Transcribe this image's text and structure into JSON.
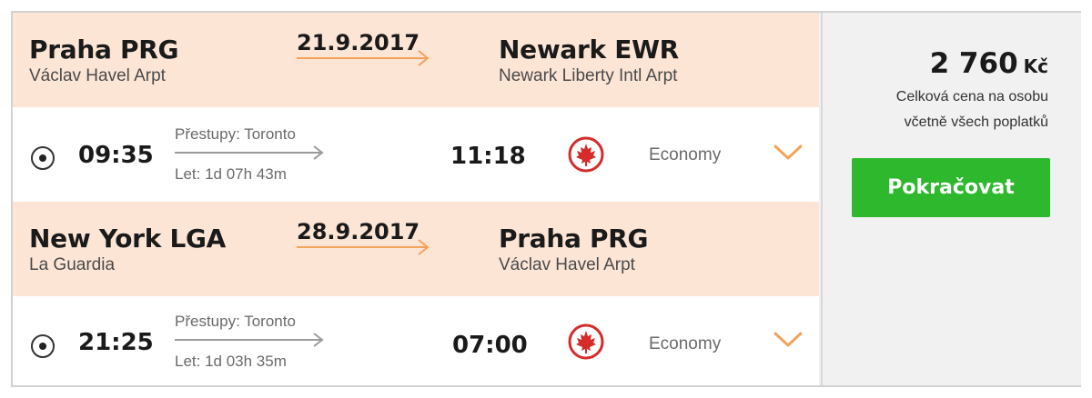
{
  "legs": [
    {
      "from_city": "Praha PRG",
      "from_airport": "Václav Havel Arpt",
      "date": "21.9.2017",
      "to_city": "Newark EWR",
      "to_airport": "Newark Liberty Intl Arpt",
      "depart": "09:35",
      "stops": "Přestupy: Toronto",
      "duration": "Let: 1d 07h 43m",
      "arrive": "11:18",
      "airline_icon": "maple-leaf-icon",
      "cabin": "Economy",
      "selected": true
    },
    {
      "from_city": "New York LGA",
      "from_airport": "La Guardia",
      "date": "28.9.2017",
      "to_city": "Praha PRG",
      "to_airport": "Václav Havel Arpt",
      "depart": "21:25",
      "stops": "Přestupy: Toronto",
      "duration": "Let: 1d 03h 35m",
      "arrive": "07:00",
      "airline_icon": "maple-leaf-icon",
      "cabin": "Economy",
      "selected": true
    }
  ],
  "price": {
    "amount": "2 760",
    "currency": "Kč",
    "note_line1": "Celková cena na osobu",
    "note_line2": "včetně všech poplatků"
  },
  "cta": {
    "label": "Pokračovat"
  },
  "colors": {
    "accent_orange": "#f5a25a",
    "header_bg": "#fde5d6",
    "button_green": "#2eb82e",
    "airline_red": "#d62b2b"
  }
}
